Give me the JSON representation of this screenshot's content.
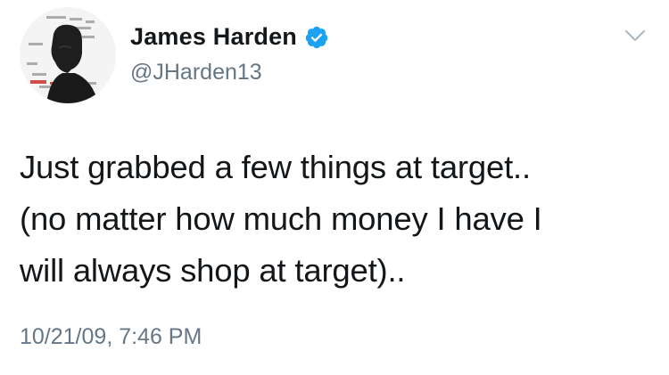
{
  "user": {
    "display_name": "James Harden",
    "handle": "@JHarden13",
    "verified": true
  },
  "tweet": {
    "text_lines": [
      "Just grabbed a few things at target..",
      "(no matter how much money I have I",
      "will always shop at target).."
    ],
    "timestamp": "10/21/09, 7:46 PM"
  },
  "icons": {
    "verified": "verified-badge-icon",
    "menu": "chevron-down-icon"
  },
  "colors": {
    "verified_blue": "#1da1f2",
    "text": "#14171a",
    "secondary_text": "#657786"
  }
}
